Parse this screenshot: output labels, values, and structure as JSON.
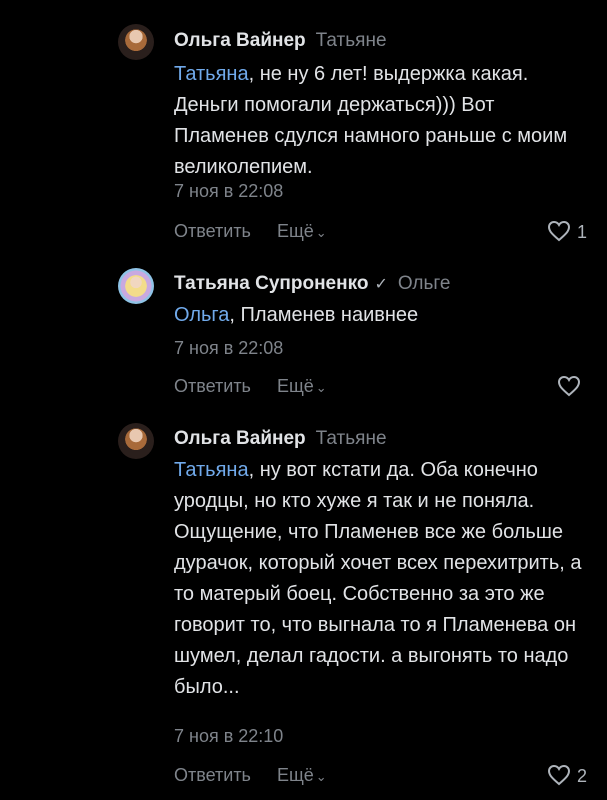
{
  "comments": [
    {
      "author": "Ольга Вайнер",
      "reply_to": "Татьяне",
      "mention": "Татьяна",
      "text": ", не ну 6 лет! выдержка какая. Деньги помогали держаться))) Вот Пламенев сдулся намного раньше с моим великолепием.",
      "date": "7 ноя в 22:08",
      "reply_label": "Ответить",
      "more_label": "Ещё",
      "likes": "1"
    },
    {
      "author": "Татьяна Супроненко",
      "reply_to": "Ольге",
      "mention": "Ольга",
      "text": ", Пламенев наивнее",
      "date": "7 ноя в 22:08",
      "reply_label": "Ответить",
      "more_label": "Ещё",
      "likes": ""
    },
    {
      "author": "Ольга Вайнер",
      "reply_to": "Татьяне",
      "mention": "Татьяна",
      "text": ", ну вот кстати да. Оба конечно уродцы, но кто хуже я так и не поняла. Ощущение, что Пламенев все же больше дурачок, который хочет всех перехитрить, а то матерый боец. Собственно за это же говорит то, что выгнала то я Пламенева он шумел, делал гадости. а выгонять то надо было...",
      "date": "7 ноя в 22:10",
      "reply_label": "Ответить",
      "more_label": "Ещё",
      "likes": "2"
    }
  ],
  "icons": {
    "heart": "heart-icon",
    "chevron": "chevron-down-icon",
    "verified": "verified-check-icon"
  },
  "colors": {
    "background": "#000000",
    "text": "#e1e3e6",
    "secondary": "#7f848b",
    "mention": "#71aaeb"
  }
}
